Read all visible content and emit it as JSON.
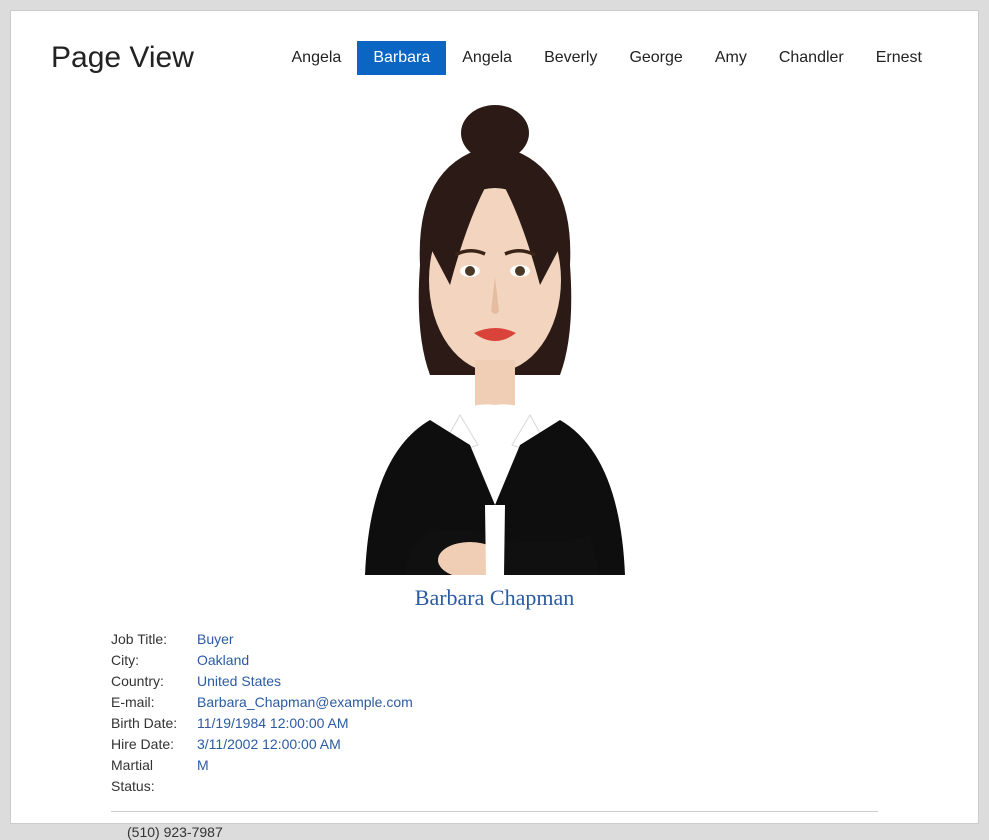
{
  "header": {
    "title": "Page View"
  },
  "tabs": [
    {
      "label": "Angela",
      "active": false
    },
    {
      "label": "Barbara",
      "active": true
    },
    {
      "label": "Angela",
      "active": false
    },
    {
      "label": "Beverly",
      "active": false
    },
    {
      "label": "George",
      "active": false
    },
    {
      "label": "Amy",
      "active": false
    },
    {
      "label": "Chandler",
      "active": false
    },
    {
      "label": "Ernest",
      "active": false
    }
  ],
  "person": {
    "full_name": "Barbara Chapman",
    "details": [
      {
        "label": "Job Title:",
        "value": "Buyer"
      },
      {
        "label": "City:",
        "value": "Oakland"
      },
      {
        "label": "Country:",
        "value": "United States"
      },
      {
        "label": "E-mail:",
        "value": "Barbara_Chapman@example.com"
      },
      {
        "label": "Birth Date:",
        "value": "11/19/1984 12:00:00 AM"
      },
      {
        "label": "Hire Date:",
        "value": "3/11/2002 12:00:00 AM"
      },
      {
        "label": "Martial Status:",
        "value": "M"
      }
    ],
    "phone": "(510) 923-7987"
  }
}
